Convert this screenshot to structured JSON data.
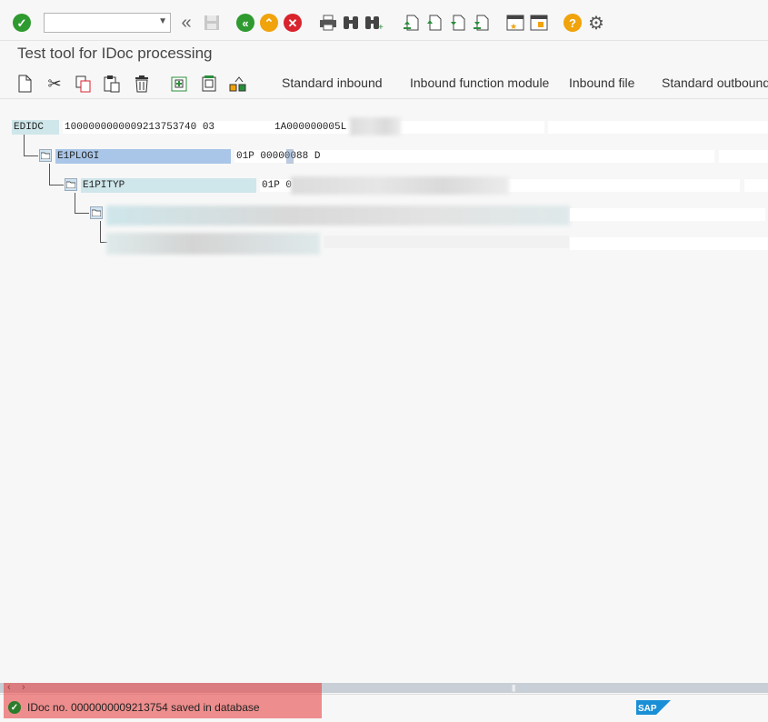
{
  "toolbar": {
    "command_field": {
      "value": "",
      "placeholder": ""
    },
    "icons": [
      "enter-icon",
      "command-field",
      "collapse-icon",
      "save-icon",
      "back-icon",
      "exit-icon",
      "cancel-icon",
      "print-icon",
      "find-icon",
      "find-next-icon",
      "first-page-icon",
      "previous-page-icon",
      "next-page-icon",
      "last-page-icon",
      "create-session-icon",
      "create-shortcut-icon",
      "help-icon",
      "settings-icon"
    ]
  },
  "page": {
    "title": "Test tool for IDoc processing"
  },
  "app_toolbar": {
    "buttons": [
      "Standard inbound",
      "Inbound function module",
      "Inbound file",
      "Standard outbound"
    ]
  },
  "tree": {
    "control_record": {
      "name": "EDIDC",
      "value1": "1000000000009213753740 03",
      "value2": "1A000000005L"
    },
    "segments": [
      {
        "name": "E1PLOGI",
        "value": "01P 00000088 D"
      },
      {
        "name": "E1PITYP",
        "value": "01P 0"
      }
    ]
  },
  "status": {
    "message": "IDoc no. 0000000009213754 saved in database",
    "type": "success"
  },
  "colors": {
    "success": "#2b7d2b",
    "nav_green": "#2f9a2f",
    "nav_orange": "#f0a30a",
    "cancel_red": "#d9232d",
    "help_yellow": "#f0a30a",
    "segment_blue": "#a9c6e8",
    "segment_teal": "#cfe6ea"
  },
  "brand": "SAP"
}
